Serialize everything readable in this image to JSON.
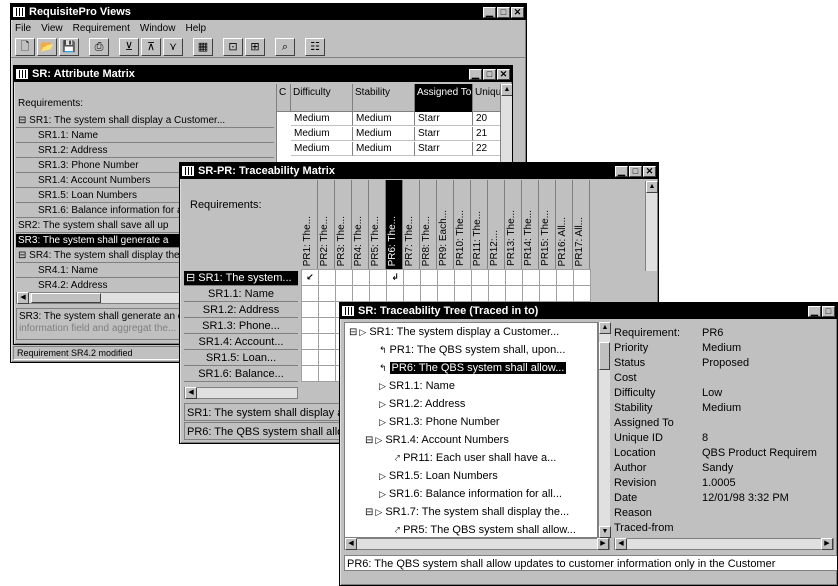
{
  "main_window": {
    "title": "RequisitePro Views",
    "menu": [
      "File",
      "View",
      "Requirement",
      "Window",
      "Help"
    ],
    "toolbar_icons": [
      "new-icon",
      "open-icon",
      "save-icon",
      "print-icon",
      "filter-icon",
      "sort-icon",
      "query-icon",
      "matrix-icon",
      "trace-icon",
      "tree-icon",
      "find-icon",
      "options-icon"
    ],
    "status": "Requirement SR4.2 modified"
  },
  "attribute_matrix": {
    "title": "SR: Attribute Matrix",
    "req_header": "Requirements:",
    "columns": [
      "C",
      "Difficulty",
      "Stability",
      "Assigned To",
      "Uniqu"
    ],
    "rows": [
      {
        "label": "⊟ SR1: The system shall display a Customer...",
        "level": 0
      },
      {
        "label": "SR1.1: Name",
        "level": 1
      },
      {
        "label": "SR1.2: Address",
        "level": 1
      },
      {
        "label": "SR1.3: Phone Number",
        "level": 1
      },
      {
        "label": "SR1.4: Account Numbers",
        "level": 1
      },
      {
        "label": "SR1.5: Loan Numbers",
        "level": 1
      },
      {
        "label": "SR1.6: Balance information for a",
        "level": 1
      },
      {
        "label": "SR2: The system shall save all up",
        "level": 0
      },
      {
        "label": "SR3: The system shall generate a",
        "level": 0,
        "selected": true
      },
      {
        "label": "⊟ SR4: The system shall display the",
        "level": 0
      },
      {
        "label": "SR4.1: Name",
        "level": 1
      },
      {
        "label": "SR4.2: Address",
        "level": 1
      }
    ],
    "data_rows": [
      [
        "Medium",
        "Medium",
        "Starr",
        "20"
      ],
      [
        "Medium",
        "Medium",
        "Starr",
        "21"
      ],
      [
        "Medium",
        "Medium",
        "Starr",
        "22"
      ]
    ],
    "footer_text": "SR3: The system shall generate an e",
    "footer_text2": "information field and aggregat the..."
  },
  "traceability_matrix": {
    "title": "SR-PR: Traceability Matrix",
    "req_header": "Requirements:",
    "columns": [
      "PR1: The...",
      "PR2: The...",
      "PR3: The...",
      "PR4: The...",
      "PR5: The...",
      "PR6: The...",
      "PR7: The...",
      "PR8: The...",
      "PR9: Each...",
      "PR10: The...",
      "PR11: The...",
      "PR12:...",
      "PR13: The...",
      "PR14: The...",
      "PR15: The...",
      "PR16: All...",
      "PR17: All..."
    ],
    "selected_column": 5,
    "rows": [
      "⊟ SR1: The system...",
      "SR1.1: Name",
      "SR1.2: Address",
      "SR1.3: Phone...",
      "SR1.4: Account...",
      "SR1.5: Loan...",
      "SR1.6: Balance..."
    ],
    "trace_marks": [
      {
        "row": 0,
        "col": 0,
        "glyph": "↙"
      },
      {
        "row": 0,
        "col": 5,
        "glyph": "↲"
      }
    ],
    "footer1": "SR1: The system shall display a",
    "footer2": "PR6: The QBS system shall allo"
  },
  "traceability_tree": {
    "title": "SR: Traceability Tree (Traced in to)",
    "items": [
      {
        "label": "SR1: The system display a Customer...",
        "indent": 0,
        "toggle": "⊟",
        "icon": "arrow-right-icon"
      },
      {
        "label": "PR1: The QBS system shall, upon...",
        "indent": 1,
        "toggle": "",
        "icon": "trace-to-icon"
      },
      {
        "label": "PR6: The QBS system shall allow...",
        "indent": 1,
        "toggle": "",
        "icon": "trace-to-icon",
        "selected": true
      },
      {
        "label": "SR1.1: Name",
        "indent": 1,
        "toggle": "",
        "icon": "arrow-right-icon"
      },
      {
        "label": "SR1.2: Address",
        "indent": 1,
        "toggle": "",
        "icon": "arrow-right-icon"
      },
      {
        "label": "SR1.3: Phone Number",
        "indent": 1,
        "toggle": "",
        "icon": "arrow-right-icon"
      },
      {
        "label": "SR1.4: Account Numbers",
        "indent": 1,
        "toggle": "⊟",
        "icon": "arrow-right-icon"
      },
      {
        "label": "PR11: Each user shall have a...",
        "indent": 2,
        "toggle": "",
        "icon": "suspect-trace-icon"
      },
      {
        "label": "SR1.5: Loan Numbers",
        "indent": 1,
        "toggle": "",
        "icon": "arrow-right-icon"
      },
      {
        "label": "SR1.6: Balance information for all...",
        "indent": 1,
        "toggle": "",
        "icon": "arrow-right-icon"
      },
      {
        "label": "SR1.7: The system shall display the...",
        "indent": 1,
        "toggle": "⊟",
        "icon": "arrow-right-icon"
      },
      {
        "label": "PR5: The QBS system shall allow...",
        "indent": 2,
        "toggle": "",
        "icon": "suspect-trace-icon"
      }
    ],
    "properties": [
      {
        "k": "Requirement:",
        "v": "PR6"
      },
      {
        "k": "Priority",
        "v": "Medium"
      },
      {
        "k": "Status",
        "v": "Proposed"
      },
      {
        "k": "Cost",
        "v": ""
      },
      {
        "k": "Difficulty",
        "v": "Low"
      },
      {
        "k": "Stability",
        "v": "Medium"
      },
      {
        "k": "Assigned To",
        "v": ""
      },
      {
        "k": "Unique ID",
        "v": "8"
      },
      {
        "k": "Location",
        "v": "QBS Product Requirem"
      },
      {
        "k": "Author",
        "v": "Sandy"
      },
      {
        "k": "Revision",
        "v": "1.0005"
      },
      {
        "k": "Date",
        "v": "12/01/98 3:32 PM"
      },
      {
        "k": "Reason",
        "v": ""
      },
      {
        "k": "Traced-from",
        "v": ""
      }
    ],
    "footer": "PR6: The QBS system shall allow updates to customer information only in the Customer"
  }
}
